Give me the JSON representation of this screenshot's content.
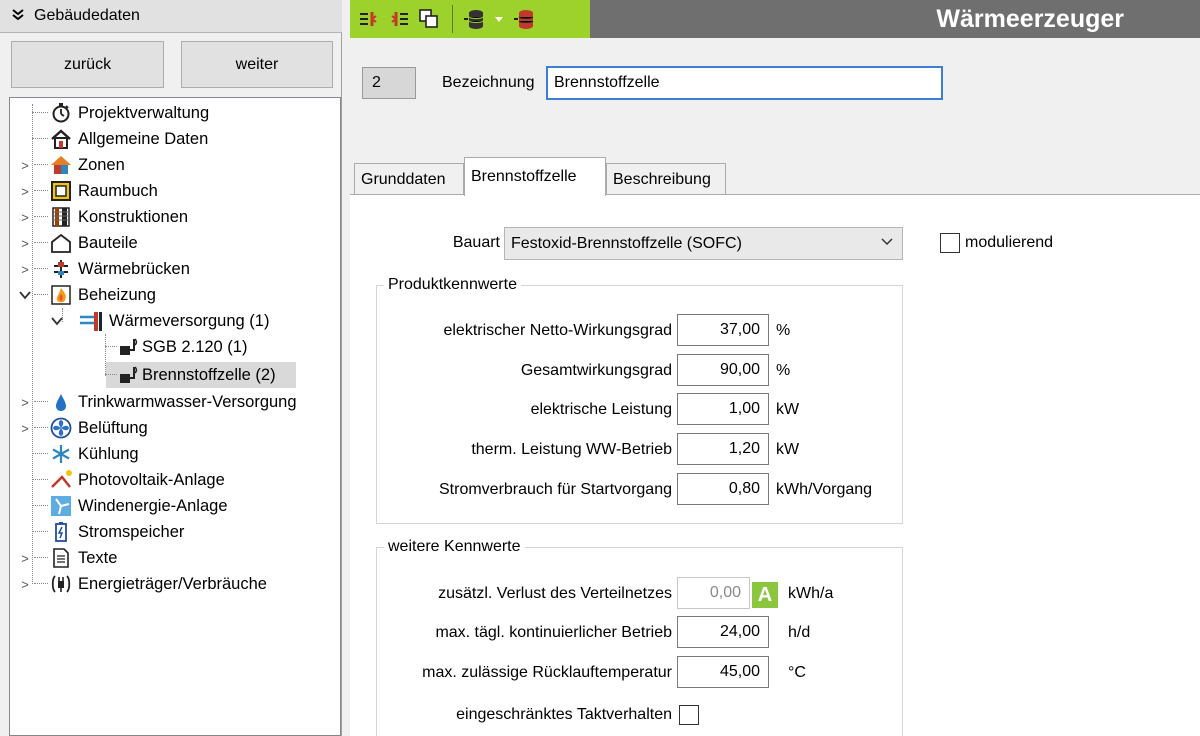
{
  "left_panel": {
    "header_title": "Gebäudedaten",
    "back_label": "zurück",
    "next_label": "weiter",
    "tree": [
      {
        "label": "Projektverwaltung",
        "icon": "stopwatch-icon"
      },
      {
        "label": "Allgemeine Daten",
        "icon": "house-icon"
      },
      {
        "label": "Zonen",
        "icon": "zone-house-icon"
      },
      {
        "label": "Raumbuch",
        "icon": "room-book-icon"
      },
      {
        "label": "Konstruktionen",
        "icon": "construction-icon"
      },
      {
        "label": "Bauteile",
        "icon": "building-outline-icon"
      },
      {
        "label": "Wärmebrücken",
        "icon": "thermal-bridge-icon"
      },
      {
        "label": "Beheizung",
        "icon": "flame-icon"
      },
      {
        "label": "Wärmeversorgung (1)",
        "icon": "heat-supply-icon"
      },
      {
        "label": "SGB 2.120 (1)",
        "icon": "boiler-icon"
      },
      {
        "label": "Brennstoffzelle (2)",
        "icon": "boiler-icon"
      },
      {
        "label": "Trinkwarmwasser-Versorgung",
        "icon": "water-drop-icon"
      },
      {
        "label": "Belüftung",
        "icon": "fan-icon"
      },
      {
        "label": "Kühlung",
        "icon": "snowflake-icon"
      },
      {
        "label": "Photovoltaik-Anlage",
        "icon": "solar-panel-icon"
      },
      {
        "label": "Windenergie-Anlage",
        "icon": "wind-energy-icon"
      },
      {
        "label": "Stromspeicher",
        "icon": "battery-icon"
      },
      {
        "label": "Texte",
        "icon": "document-icon"
      },
      {
        "label": "Energieträger/Verbräuche",
        "icon": "plug-icon"
      }
    ]
  },
  "toolbar": {
    "icons": [
      "move-left-icon",
      "move-right-icon",
      "copy-icon",
      "database-add-icon",
      "dropdown-arrow-icon",
      "database-delete-icon"
    ]
  },
  "header": {
    "title": "Wärmeerzeuger"
  },
  "form": {
    "record_number": "2",
    "bezeichnung_label": "Bezeichnung",
    "bezeichnung_value": "Brennstoffzelle",
    "tabs": [
      "Grunddaten",
      "Brennstoffzelle",
      "Beschreibung"
    ],
    "active_tab": "Brennstoffzelle",
    "bauart_label": "Bauart",
    "bauart_value": "Festoxid-Brennstoffzelle (SOFC)",
    "modulierend_label": "modulierend",
    "modulierend_checked": false,
    "produkt": {
      "title": "Produktkennwerte",
      "rows": [
        {
          "label": "elektrischer Netto-Wirkungsgrad",
          "value": "37,00",
          "unit": "%"
        },
        {
          "label": "Gesamtwirkungsgrad",
          "value": "90,00",
          "unit": "%"
        },
        {
          "label": "elektrische Leistung",
          "value": "1,00",
          "unit": "kW"
        },
        {
          "label": "therm. Leistung WW-Betrieb",
          "value": "1,20",
          "unit": "kW"
        },
        {
          "label": "Stromverbrauch für Startvorgang",
          "value": "0,80",
          "unit": "kWh/Vorgang"
        }
      ]
    },
    "weitere": {
      "title": "weitere Kennwerte",
      "rows": [
        {
          "label": "zusätzl. Verlust des Verteilnetzes",
          "value": "0,00",
          "unit": "kWh/a",
          "badge": "A",
          "disabled": true
        },
        {
          "label": "max. tägl. kontinuierlicher Betrieb",
          "value": "24,00",
          "unit": "h/d"
        },
        {
          "label": "max. zulässige Rücklauftemperatur",
          "value": "45,00",
          "unit": "°C"
        }
      ],
      "taktverhalten_label": "eingeschränktes Taktverhalten",
      "taktverhalten_checked": false
    }
  },
  "colors": {
    "toolbar_green": "#9dd12c",
    "header_gray": "#6f6f6f",
    "focus_blue": "#3c7fd6",
    "badge_green": "#8cc63f"
  }
}
